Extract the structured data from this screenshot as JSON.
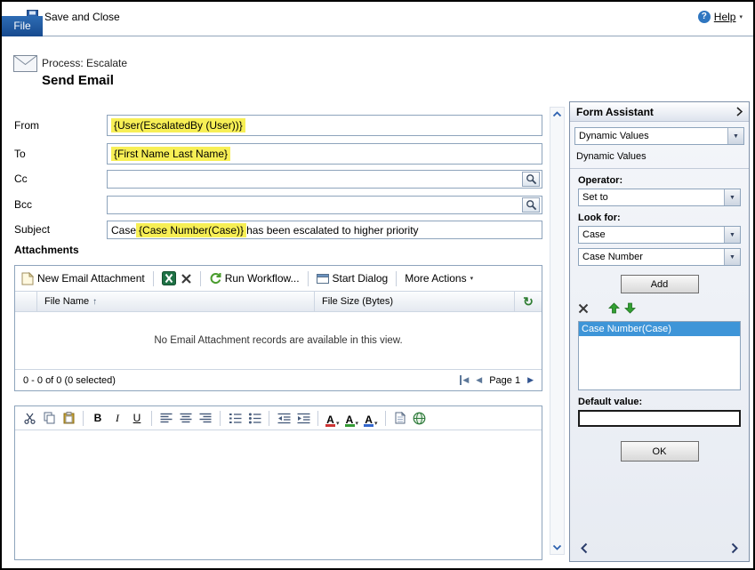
{
  "topbar": {
    "file_tab": "File",
    "save_and_close": "Save and Close",
    "help_label": "Help"
  },
  "header": {
    "process_label": "Process: Escalate",
    "title": "Send Email"
  },
  "form": {
    "fields": {
      "from": {
        "label": "From",
        "value": "{User(EscalatedBy (User))}"
      },
      "to": {
        "label": "To",
        "value": "{First Name Last Name}"
      },
      "cc": {
        "label": "Cc",
        "value": ""
      },
      "bcc": {
        "label": "Bcc",
        "value": ""
      },
      "subject": {
        "label": "Subject",
        "prefix": "Case ",
        "dynamic": "{Case Number(Case)}",
        "suffix": " has been escalated to higher priority"
      }
    },
    "attachments_label": "Attachments"
  },
  "attachments": {
    "toolbar": {
      "new_label": "New Email Attachment",
      "run_workflow_label": "Run Workflow...",
      "start_dialog_label": "Start Dialog",
      "more_actions_label": "More Actions"
    },
    "grid": {
      "file_name_header": "File Name",
      "file_size_header": "File Size (Bytes)",
      "empty_message": "No Email Attachment records are available in this view.",
      "record_count": "0 - 0 of 0 (0 selected)",
      "page_label": "Page 1"
    }
  },
  "editor": {
    "bold": "B",
    "italic": "I",
    "underline": "U",
    "letter_a": "A",
    "body_text": ""
  },
  "form_assistant": {
    "title": "Form Assistant",
    "selector_value": "Dynamic Values",
    "section_label": "Dynamic Values",
    "operator_label": "Operator:",
    "operator_value": "Set to",
    "look_for_label": "Look for:",
    "entity_value": "Case",
    "attribute_value": "Case Number",
    "add_button": "Add",
    "items": [
      "Case Number(Case)"
    ],
    "default_value_label": "Default value:",
    "default_value": "",
    "ok_button": "OK"
  },
  "icons": {
    "help": "?",
    "dropdown": "▼",
    "dropdown_small": "▾",
    "sort_asc": "↑",
    "refresh": "↻",
    "page_prev": "◀",
    "page_next": "▶",
    "page_first": "◀"
  },
  "colors": {
    "file_tab_blue": "#1d5a9b",
    "highlight_yellow": "#f7ef55",
    "selection_blue": "#3e95d8",
    "arrow_green": "#33a033"
  }
}
